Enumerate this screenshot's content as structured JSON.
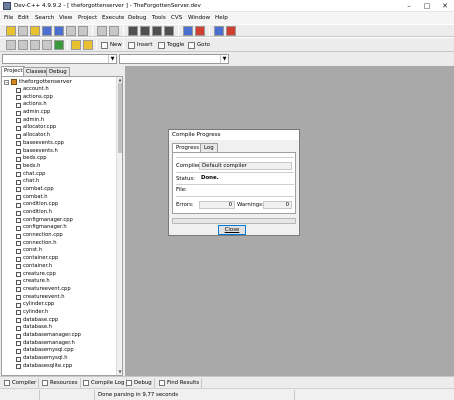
{
  "window": {
    "title": "Dev-C++ 4.9.9.2  -  [ theforgottenserver ]  -  TheForgottenServer.dev",
    "controls": [
      "–",
      "□",
      "✕"
    ]
  },
  "menu": [
    "File",
    "Edit",
    "Search",
    "View",
    "Project",
    "Execute",
    "Debug",
    "Tools",
    "CVS",
    "Window",
    "Help"
  ],
  "toolbar2": {
    "new_label": "New",
    "insert_label": "Insert",
    "toggle_label": "Toggle",
    "goto_label": "Goto"
  },
  "left_tabs": [
    "Project",
    "Classes",
    "Debug"
  ],
  "tree": {
    "root": "theforgottenserver",
    "root_expander": "−",
    "files": [
      "account.h",
      "actions.cpp",
      "actions.h",
      "admin.cpp",
      "admin.h",
      "allocator.cpp",
      "allocator.h",
      "baseevents.cpp",
      "baseevents.h",
      "beds.cpp",
      "beds.h",
      "chat.cpp",
      "chat.h",
      "combat.cpp",
      "combat.h",
      "condition.cpp",
      "condition.h",
      "configmanager.cpp",
      "configmanager.h",
      "connection.cpp",
      "connection.h",
      "const.h",
      "container.cpp",
      "container.h",
      "creature.cpp",
      "creature.h",
      "creatureevent.cpp",
      "creatureevent.h",
      "cylinder.cpp",
      "cylinder.h",
      "database.cpp",
      "database.h",
      "databasemanager.cpp",
      "databasemanager.h",
      "databasemysql.cpp",
      "databasemysql.h",
      "databasesqlite.cpp"
    ]
  },
  "dialog": {
    "title": "Compile Progress",
    "tabs": [
      "Progress",
      "Log"
    ],
    "compiler_label": "Compiler:",
    "compiler_value": "Default compiler",
    "status_label": "Status:",
    "status_value": "Done.",
    "file_label": "File:",
    "file_value": "",
    "errors_label": "Errors:",
    "errors_value": "0",
    "warnings_label": "Warnings:",
    "warnings_value": "0",
    "progress_fraction": 0.0,
    "close_label": "Close"
  },
  "bottom_tabs": [
    "Compiler",
    "Resources",
    "Compile Log",
    "Debug",
    "Find Results"
  ],
  "status": {
    "message": "Done parsing in 9,77 seconds"
  }
}
